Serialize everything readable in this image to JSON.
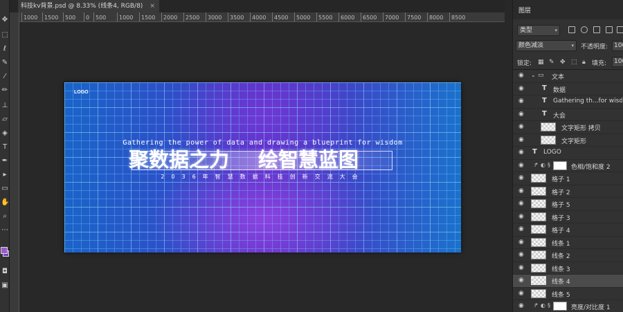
{
  "document_tab": {
    "title": "科技kv背景.psd @ 8.33% (线条4, RGB/8)",
    "close": "×"
  },
  "ruler": {
    "ticks": [
      "1000",
      "1500",
      "500",
      "0",
      "500",
      "1000",
      "1500",
      "2000",
      "2500",
      "3000",
      "3500",
      "4000",
      "4500",
      "5000",
      "5500",
      "6000",
      "6500",
      "7000",
      "7500",
      "8000",
      "8500"
    ]
  },
  "artboard": {
    "logo": "LOGO",
    "subtitle_en": "Gathering the power of data and drawing a blueprint for wisdom",
    "title_left": "聚数据之力",
    "title_right": "绘智慧蓝图",
    "subtitle_cn": "2036年智慧数据科技创新交流大会"
  },
  "panel": {
    "tab": "图层",
    "filter_kind": "类型",
    "blend_mode": "颜色减淡",
    "opacity_label": "不透明度:",
    "opacity_value": "100",
    "lock_label": "锁定:",
    "fill_label": "填充:",
    "fill_value": "100",
    "layers": [
      {
        "name": "文本",
        "kind": "group"
      },
      {
        "name": "数据",
        "kind": "text"
      },
      {
        "name": "Gathering th...for wisdom.",
        "kind": "text"
      },
      {
        "name": "大会",
        "kind": "text"
      },
      {
        "name": "文字矩形 拷贝",
        "kind": "pixel"
      },
      {
        "name": "文字矩形",
        "kind": "pixel"
      },
      {
        "name": "LOGO",
        "kind": "text"
      },
      {
        "name": "色相/饱和度 2",
        "kind": "adjust"
      },
      {
        "name": "格子 1",
        "kind": "pixel"
      },
      {
        "name": "格子 2",
        "kind": "pixel"
      },
      {
        "name": "格子 5",
        "kind": "pixel"
      },
      {
        "name": "格子 3",
        "kind": "pixel"
      },
      {
        "name": "格子 4",
        "kind": "pixel"
      },
      {
        "name": "线条 1",
        "kind": "pixel"
      },
      {
        "name": "线条 2",
        "kind": "pixel"
      },
      {
        "name": "线条 3",
        "kind": "pixel"
      },
      {
        "name": "线条 4",
        "kind": "pixel",
        "selected": true
      },
      {
        "name": "线条 5",
        "kind": "pixel"
      },
      {
        "name": "亮度/对比度 1",
        "kind": "adjust"
      }
    ]
  }
}
